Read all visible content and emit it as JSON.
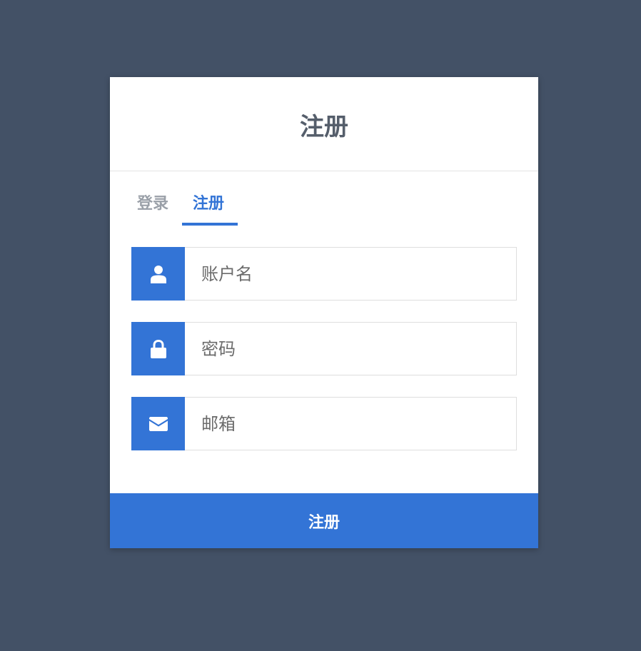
{
  "card": {
    "title": "注册"
  },
  "tabs": [
    {
      "label": "登录",
      "active": false
    },
    {
      "label": "注册",
      "active": true
    }
  ],
  "fields": {
    "account": {
      "placeholder": "账户名",
      "value": "",
      "icon": "user-icon"
    },
    "password": {
      "placeholder": "密码",
      "value": "",
      "icon": "lock-icon"
    },
    "email": {
      "placeholder": "邮箱",
      "value": "",
      "icon": "envelope-icon"
    }
  },
  "submit": {
    "label": "注册"
  },
  "colors": {
    "background": "#435166",
    "accent": "#3374d6",
    "title": "#555e6b",
    "inactive_tab": "#9aa0a8"
  }
}
